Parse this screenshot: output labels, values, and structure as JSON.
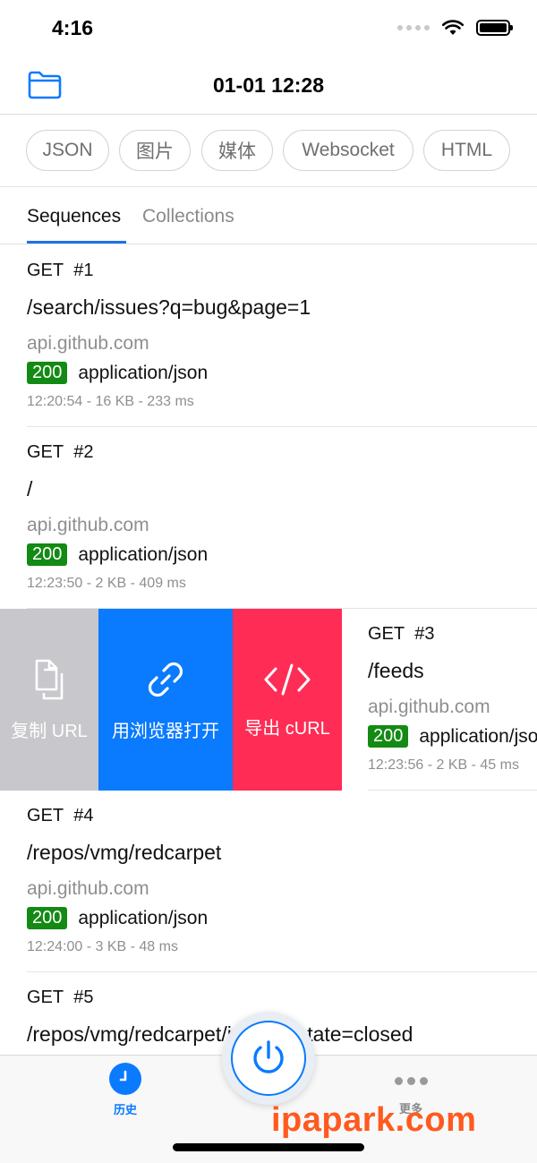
{
  "status_bar": {
    "time": "4:16"
  },
  "nav": {
    "title": "01-01 12:28",
    "folder_icon": "folder-icon"
  },
  "filters": [
    {
      "label": "JSON"
    },
    {
      "label": "图片"
    },
    {
      "label": "媒体"
    },
    {
      "label": "Websocket"
    },
    {
      "label": "HTML"
    }
  ],
  "segments": {
    "active": "Sequences",
    "inactive": "Collections"
  },
  "requests": [
    {
      "method": "GET",
      "number": "#1",
      "path": "/search/issues?q=bug&page=1",
      "host": "api.github.com",
      "status": "200",
      "content_type": "application/json",
      "meta": "12:20:54 - 16 KB - 233 ms"
    },
    {
      "method": "GET",
      "number": "#2",
      "path": "/",
      "host": "api.github.com",
      "status": "200",
      "content_type": "application/json",
      "meta": "12:23:50 - 2 KB - 409 ms"
    },
    {
      "method": "GET",
      "number": "#3",
      "path": "/feeds",
      "host": "api.github.com",
      "status": "200",
      "content_type": "application/json",
      "meta": "12:23:56 - 2 KB - 45 ms"
    },
    {
      "method": "GET",
      "number": "#4",
      "path": "/repos/vmg/redcarpet",
      "host": "api.github.com",
      "status": "200",
      "content_type": "application/json",
      "meta": "12:24:00 - 3 KB - 48 ms"
    },
    {
      "method": "GET",
      "number": "#5",
      "path": "/repos/vmg/redcarpet/issues?state=closed",
      "host": "",
      "status": "",
      "content_type": "",
      "meta": ""
    }
  ],
  "swipe_actions": {
    "copy_url": "复制 URL",
    "open_browser": "用浏览器打开",
    "export_curl": "导出 cURL"
  },
  "tab_bar": {
    "history": "历史",
    "more": "更多"
  },
  "watermark": "ipapark.com",
  "colors": {
    "accent": "#0a7aff",
    "status_ok": "#138a13",
    "action_copy": "#c7c7cc",
    "action_open": "#0a7aff",
    "action_export": "#ff2d55"
  }
}
